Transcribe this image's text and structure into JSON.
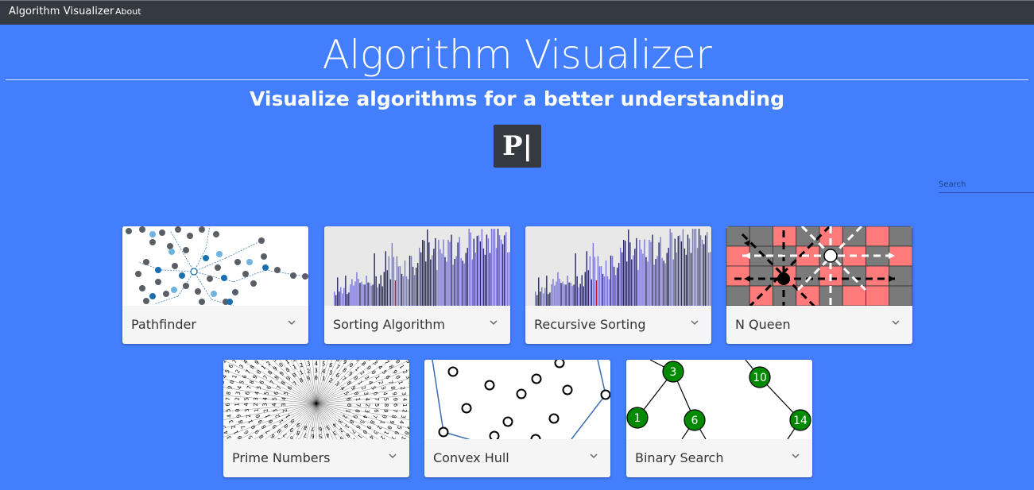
{
  "navbar": {
    "brand": "Algorithm Visualizer",
    "about": "About"
  },
  "header": {
    "title": "Algorithm Visualizer",
    "subtitle": "Visualize algorithms for a better understanding",
    "logo_text": "P|"
  },
  "search": {
    "placeholder": "Search"
  },
  "cards": [
    {
      "label": "Pathfinder",
      "icon": "chevron-down-icon"
    },
    {
      "label": "Sorting Algorithm",
      "icon": "chevron-down-icon"
    },
    {
      "label": "Recursive Sorting",
      "icon": "chevron-down-icon"
    },
    {
      "label": "N Queen",
      "icon": "chevron-down-icon"
    },
    {
      "label": "Prime Numbers",
      "icon": "chevron-down-icon"
    },
    {
      "label": "Convex Hull",
      "icon": "chevron-down-icon"
    },
    {
      "label": "Binary Search",
      "icon": "chevron-down-icon"
    }
  ],
  "binary_search_nodes": [
    "3",
    "10",
    "1",
    "6",
    "14"
  ],
  "colors": {
    "background": "#437ffc",
    "navbar": "#343a40",
    "card_footer": "#f5f5f5",
    "tree_node": "#008a00",
    "queen_red": "#ff7b7b",
    "queen_gray": "#7a7a7a"
  }
}
